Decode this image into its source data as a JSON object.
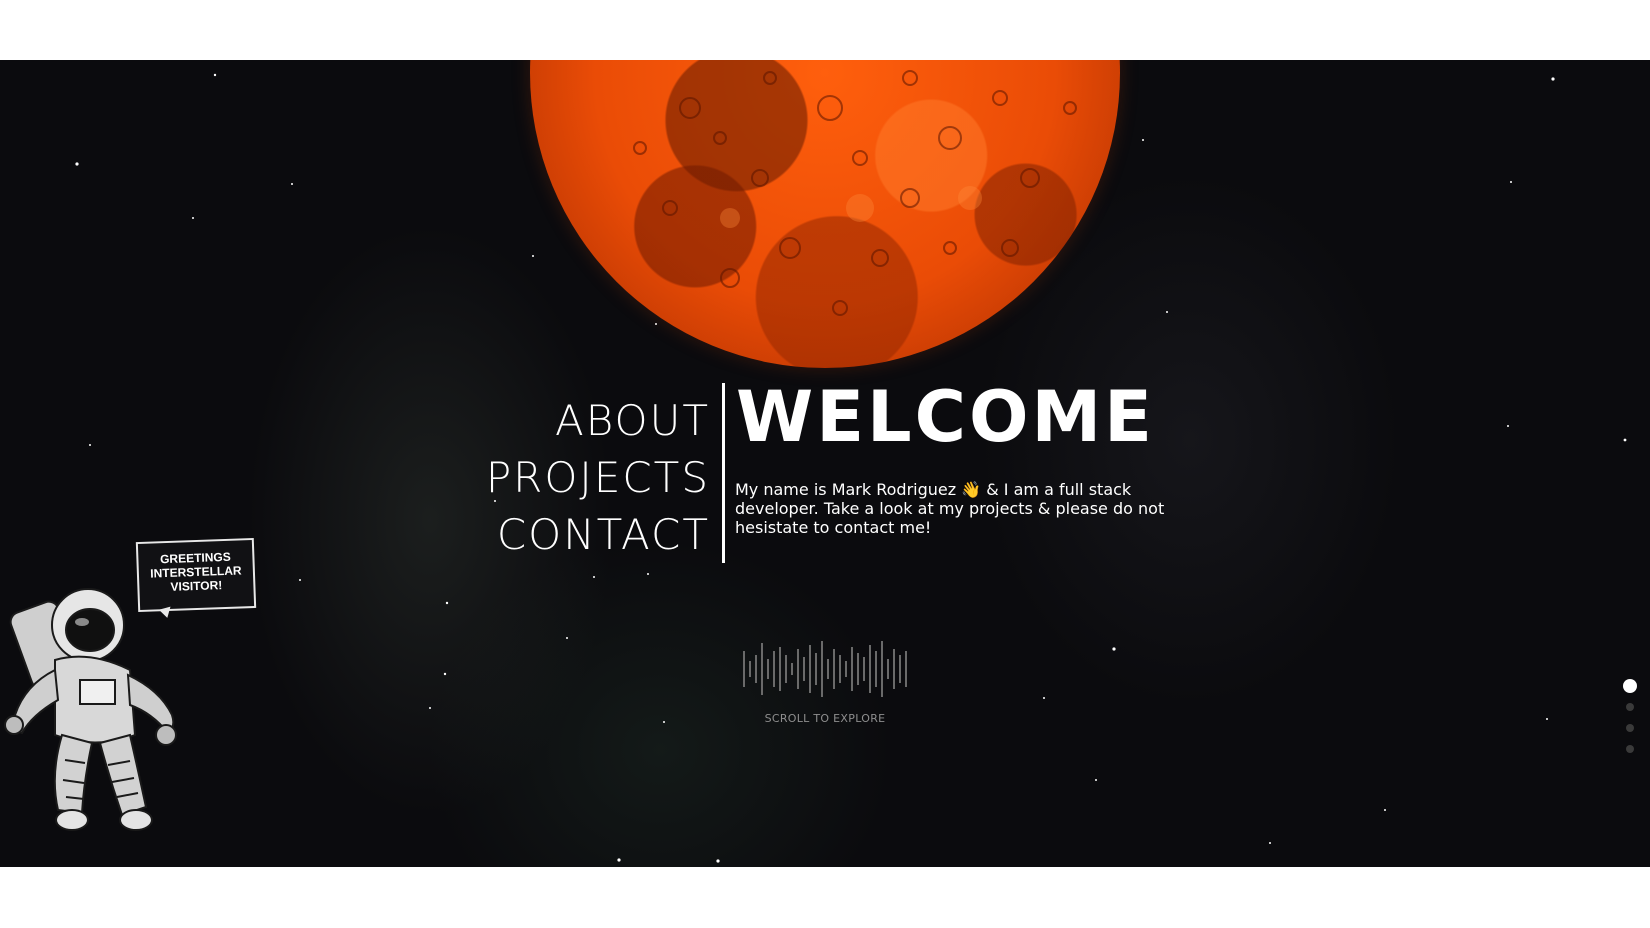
{
  "nav": {
    "items": [
      {
        "label": "ABOUT"
      },
      {
        "label": "PROJECTS"
      },
      {
        "label": "CONTACT"
      }
    ]
  },
  "hero": {
    "title": "WELCOME",
    "intro": "My name is Mark Rodriguez 👋 & I am a full stack developer. Take a look at my projects & please do not hesistate to contact me!"
  },
  "scroll": {
    "label": "SCROLL TO EXPLORE"
  },
  "astronaut": {
    "speech_bubble": "GREETINGS INTERSTELLAR VISITOR!"
  },
  "page_dots": {
    "count": 4,
    "active_index": 0
  },
  "colors": {
    "background": "#0b0b0e",
    "planet": "#ea4c06",
    "text": "#ffffff",
    "muted_text": "#8e8e8e"
  },
  "icons": [
    "planet-illustration",
    "astronaut-illustration",
    "waveform-icon",
    "wave-emoji"
  ]
}
